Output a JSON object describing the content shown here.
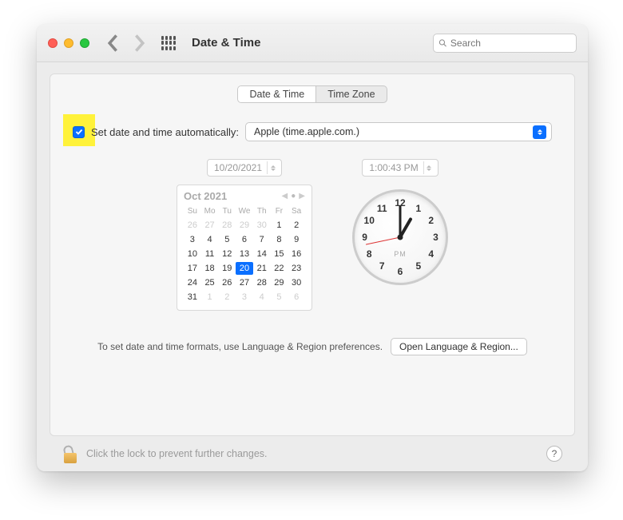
{
  "window": {
    "title": "Date & Time"
  },
  "search": {
    "placeholder": "Search"
  },
  "tabs": {
    "date_time": "Date & Time",
    "time_zone": "Time Zone"
  },
  "auto": {
    "label": "Set date and time automatically:",
    "server": "Apple (time.apple.com.)"
  },
  "date_field": "10/20/2021",
  "time_field": "1:00:43 PM",
  "calendar": {
    "month_label": "Oct 2021",
    "dow": [
      "Su",
      "Mo",
      "Tu",
      "We",
      "Th",
      "Fr",
      "Sa"
    ],
    "leading_off": [
      26,
      27,
      28,
      29,
      30
    ],
    "days": [
      1,
      2,
      3,
      4,
      5,
      6,
      7,
      8,
      9,
      10,
      11,
      12,
      13,
      14,
      15,
      16,
      17,
      18,
      19,
      20,
      21,
      22,
      23,
      24,
      25,
      26,
      27,
      28,
      29,
      30,
      31
    ],
    "trailing_off": [
      1,
      2,
      3,
      4,
      5,
      6
    ],
    "selected": 20
  },
  "clock": {
    "ampm": "PM"
  },
  "hint": "To set date and time formats, use Language & Region preferences.",
  "open_btn": "Open Language & Region...",
  "lock_text": "Click the lock to prevent further changes.",
  "help": "?"
}
